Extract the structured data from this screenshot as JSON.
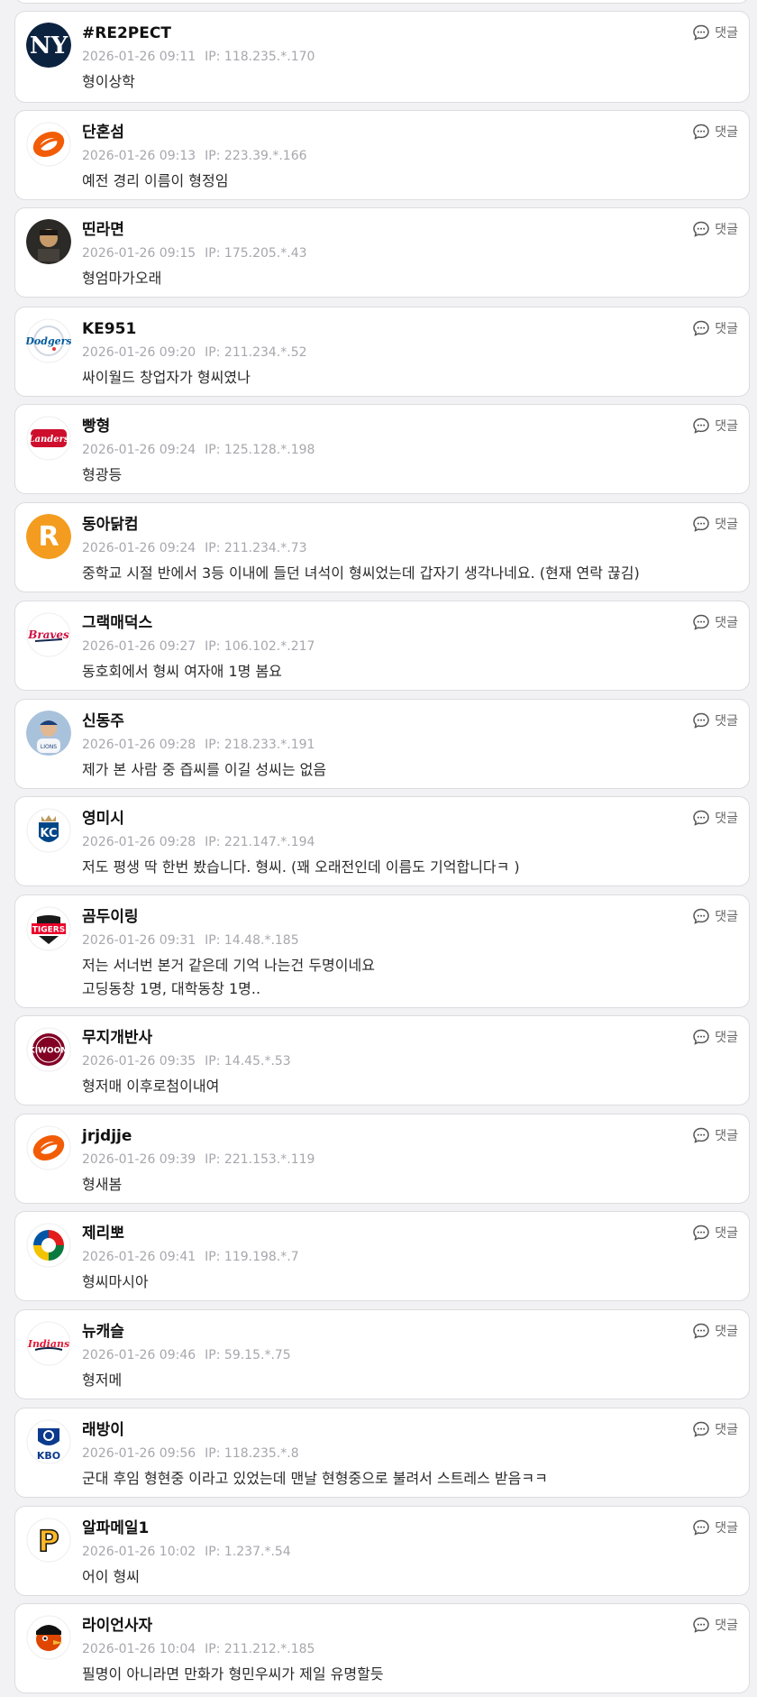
{
  "reply_label": "댓글",
  "comments": [
    {
      "nick": "#RE2PECT",
      "time": "2026-01-26 09:11",
      "ip": "IP: 118.235.*.170",
      "lines": [
        "형이상학"
      ],
      "avatar_icon": "yankees-logo-icon"
    },
    {
      "nick": "단혼섬",
      "time": "2026-01-26 09:13",
      "ip": "IP: 223.39.*.166",
      "lines": [
        "예전 경리 이름이 형정임"
      ],
      "avatar_icon": "eagles-logo-icon"
    },
    {
      "nick": "띤라면",
      "time": "2026-01-26 09:15",
      "ip": "IP: 175.205.*.43",
      "lines": [
        "형엄마가오래"
      ],
      "avatar_icon": "photo-avatar-icon"
    },
    {
      "nick": "KE951",
      "time": "2026-01-26 09:20",
      "ip": "IP: 211.234.*.52",
      "lines": [
        "싸이월드 창업자가 형씨였나"
      ],
      "avatar_icon": "dodgers-logo-icon"
    },
    {
      "nick": "빵형",
      "time": "2026-01-26 09:24",
      "ip": "IP: 125.128.*.198",
      "lines": [
        "형광등"
      ],
      "avatar_icon": "landers-logo-icon"
    },
    {
      "nick": "동아닭컴",
      "time": "2026-01-26 09:24",
      "ip": "IP: 211.234.*.73",
      "lines": [
        "중학교 시절 반에서 3등 이내에 들던 녀석이 형씨었는데 갑자기 생각나네요. (현재 연락 끊김)"
      ],
      "avatar_icon": "r-letter-logo-icon"
    },
    {
      "nick": "그랙매덕스",
      "time": "2026-01-26 09:27",
      "ip": "IP: 106.102.*.217",
      "lines": [
        "동호회에서 형씨 여자애 1명 봄요"
      ],
      "avatar_icon": "braves-logo-icon"
    },
    {
      "nick": "신동주",
      "time": "2026-01-26 09:28",
      "ip": "IP: 218.233.*.191",
      "lines": [
        "제가 본 사람 중 즙씨를 이길 성씨는 없음"
      ],
      "avatar_icon": "player-photo-avatar-icon"
    },
    {
      "nick": "영미시",
      "time": "2026-01-26 09:28",
      "ip": "IP: 221.147.*.194",
      "lines": [
        "저도 평생 딱 한번 봤습니다. 형씨. (꽤 오래전인데 이름도 기억합니다ㅋ )"
      ],
      "avatar_icon": "royals-logo-icon"
    },
    {
      "nick": "곰두이링",
      "time": "2026-01-26 09:31",
      "ip": "IP: 14.48.*.185",
      "lines": [
        "저는 서너번 본거 같은데 기억 나는건 두명이네요",
        "고딩동창 1명, 대학동창 1명.."
      ],
      "avatar_icon": "tigers-logo-icon"
    },
    {
      "nick": "무지개반사",
      "time": "2026-01-26 09:35",
      "ip": "IP: 14.45.*.53",
      "lines": [
        "형저매 이후로첨이내여"
      ],
      "avatar_icon": "kiwoom-logo-icon"
    },
    {
      "nick": "jrjdjje",
      "time": "2026-01-26 09:39",
      "ip": "IP: 221.153.*.119",
      "lines": [
        "형새봄"
      ],
      "avatar_icon": "eagles-logo-icon"
    },
    {
      "nick": "제리뽀",
      "time": "2026-01-26 09:41",
      "ip": "IP: 119.198.*.7",
      "lines": [
        "형씨마시아"
      ],
      "avatar_icon": "wbc-logo-icon"
    },
    {
      "nick": "뉴캐슬",
      "time": "2026-01-26 09:46",
      "ip": "IP: 59.15.*.75",
      "lines": [
        "형저메"
      ],
      "avatar_icon": "indians-logo-icon"
    },
    {
      "nick": "래방이",
      "time": "2026-01-26 09:56",
      "ip": "IP: 118.235.*.8",
      "lines": [
        "군대 후임 형현중 이라고 있었는데 맨날 현형중으로 불려서 스트레스 받음ㅋㅋ"
      ],
      "avatar_icon": "kbo-logo-icon"
    },
    {
      "nick": "알파메일1",
      "time": "2026-01-26 10:02",
      "ip": "IP: 1.237.*.54",
      "lines": [
        "어이 형씨"
      ],
      "avatar_icon": "pirates-logo-icon"
    },
    {
      "nick": "라이언사자",
      "time": "2026-01-26 10:04",
      "ip": "IP: 211.212.*.185",
      "lines": [
        "필명이 아니라면 만화가 형민우씨가 제일 유명할듯"
      ],
      "avatar_icon": "orioles-logo-icon"
    }
  ]
}
